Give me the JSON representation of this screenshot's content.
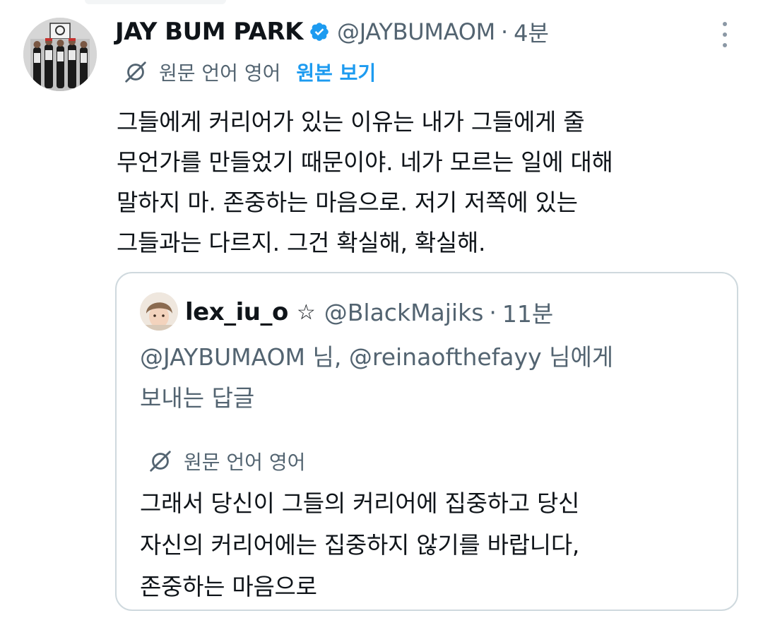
{
  "tweet": {
    "author_name": "JAY BUM PARK",
    "author_handle": "@JAYBUMAOM",
    "separator": "·",
    "time": "4분",
    "verified": true,
    "translate": {
      "label": "원문 언어 영어",
      "show_original": "원본 보기"
    },
    "text_lines": [
      "그들에게 커리어가 있는 이유는 내가 그들에게 줄",
      "무언가를 만들었기 때문이야. 네가 모르는 일에 대해",
      "말하지 마. 존중하는 마음으로. 저기 저쪽에 있는",
      "그들과는 다르지. 그건 확실해, 확실해."
    ]
  },
  "quote": {
    "author_name": "lex_iu_o",
    "star": "☆",
    "author_handle": "@BlackMajiks",
    "separator": "·",
    "time": "11분",
    "reply_lines": [
      "@JAYBUMAOM 님, @reinaofthefayy 님에게",
      "보내는 답글"
    ],
    "translate_label": "원문 언어 영어",
    "text_lines": [
      "그래서 당신이 그들의 커리어에 집중하고 당신",
      "자신의 커리어에는 집중하지 않기를 바랍니다,",
      "존중하는 마음으로"
    ]
  },
  "colors": {
    "text": "#0f1419",
    "secondary": "#536471",
    "accent": "#1d9bf0",
    "border": "#cfd9de"
  },
  "icons": {
    "verified": "verified-badge-icon",
    "translate": "translate-icon",
    "more": "more-options-icon"
  }
}
